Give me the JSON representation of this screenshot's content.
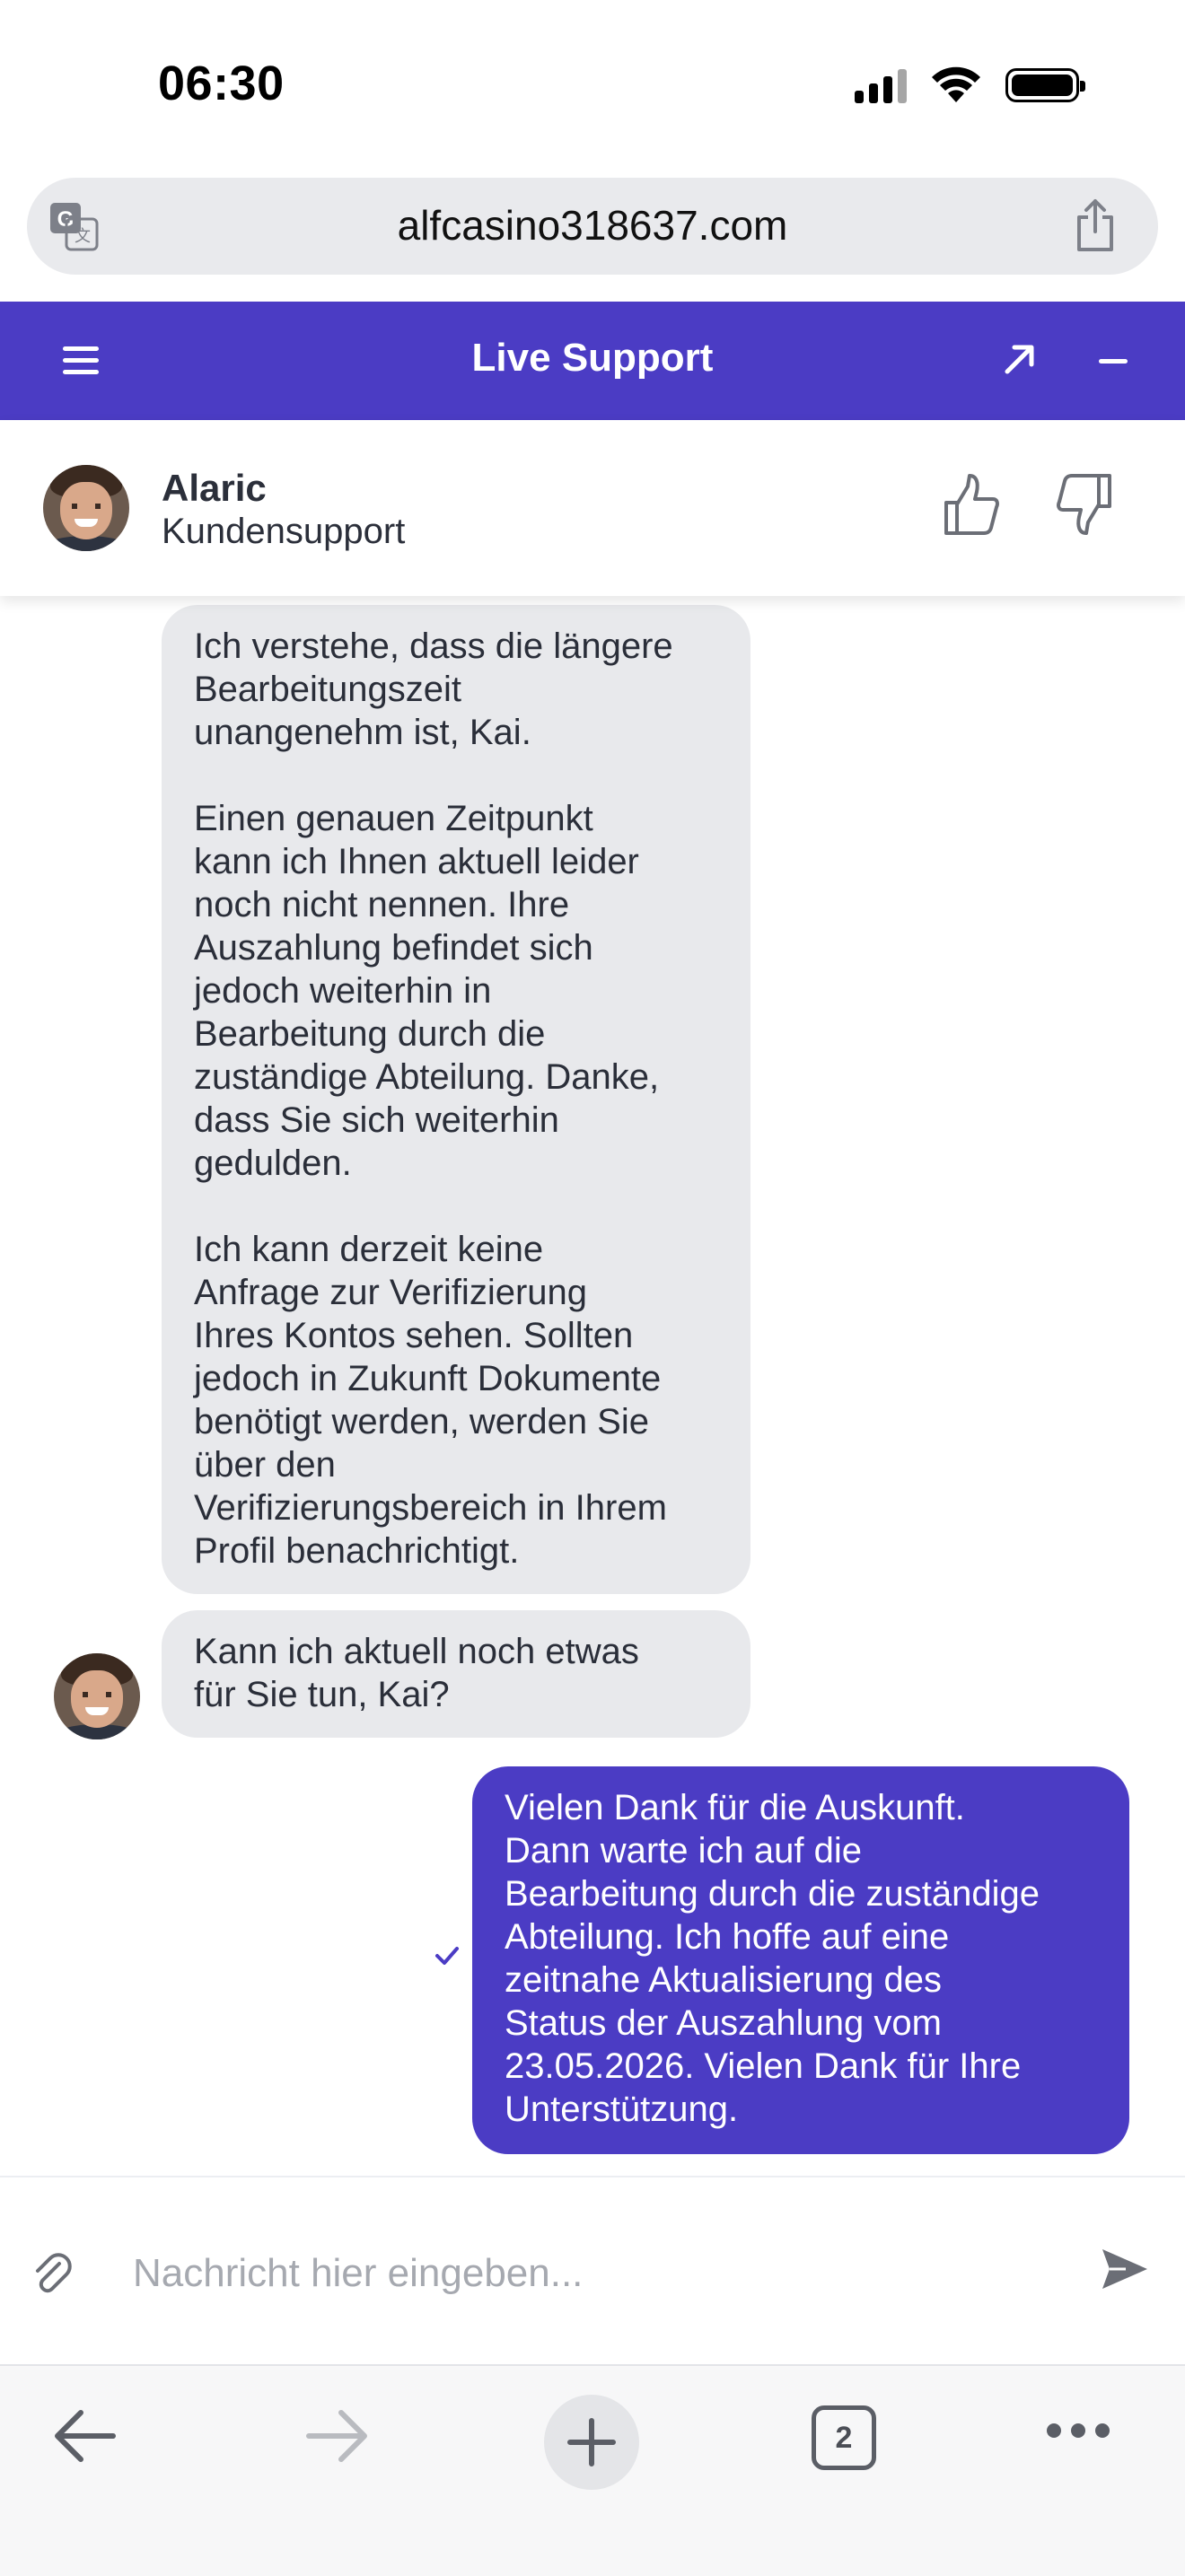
{
  "status_bar": {
    "time": "06:30"
  },
  "browser": {
    "url": "alfcasino318637.com",
    "open_tabs": "2",
    "icons": {
      "translate": "translate-icon",
      "share": "share-icon",
      "back": "arrow-left-icon",
      "forward": "arrow-right-icon",
      "new_tab": "plus-icon",
      "tabs": "tabs-icon",
      "more": "ellipsis-icon"
    }
  },
  "chat_header": {
    "title": "Live Support",
    "background_color": "#4b3cc4",
    "icons": {
      "menu": "hamburger-menu-icon",
      "expand": "expand-arrow-icon",
      "minimize": "minimize-icon"
    }
  },
  "agent": {
    "name": "Alaric",
    "role": "Kundensupport",
    "icons": {
      "like": "thumbs-up-icon",
      "dislike": "thumbs-down-icon"
    }
  },
  "messages": [
    {
      "sender": "agent",
      "text": "Ich verstehe, dass die längere\nBearbeitungszeit\nunangenehm ist, Kai.\n\nEinen genauen Zeitpunkt\nkann ich Ihnen aktuell leider\nnoch nicht nennen. Ihre\nAuszahlung befindet sich\njedoch weiterhin in\nBearbeitung durch die\nzuständige Abteilung. Danke,\ndass Sie sich weiterhin\ngedulden.\n\nIch kann derzeit keine\nAnfrage zur Verifizierung\nIhres Kontos sehen. Sollten\njedoch in Zukunft Dokumente\nbenötigt werden, werden Sie\nüber den\nVerifizierungsbereich in Ihrem\nProfil benachrichtigt."
    },
    {
      "sender": "agent",
      "text": "Kann ich aktuell noch etwas\nfür Sie tun, Kai?"
    },
    {
      "sender": "user",
      "text": "Vielen Dank für die Auskunft.\nDann warte ich auf die\nBearbeitung durch die zuständige\nAbteilung. Ich hoffe auf eine\nzeitnahe Aktualisierung des\nStatus der Auszahlung vom\n23.05.2026. Vielen Dank für Ihre\nUnterstützung.",
      "status_icon": "check-icon"
    }
  ],
  "composer": {
    "placeholder": "Nachricht hier eingeben...",
    "value": "",
    "icons": {
      "attach": "paperclip-icon",
      "send": "send-icon"
    }
  }
}
